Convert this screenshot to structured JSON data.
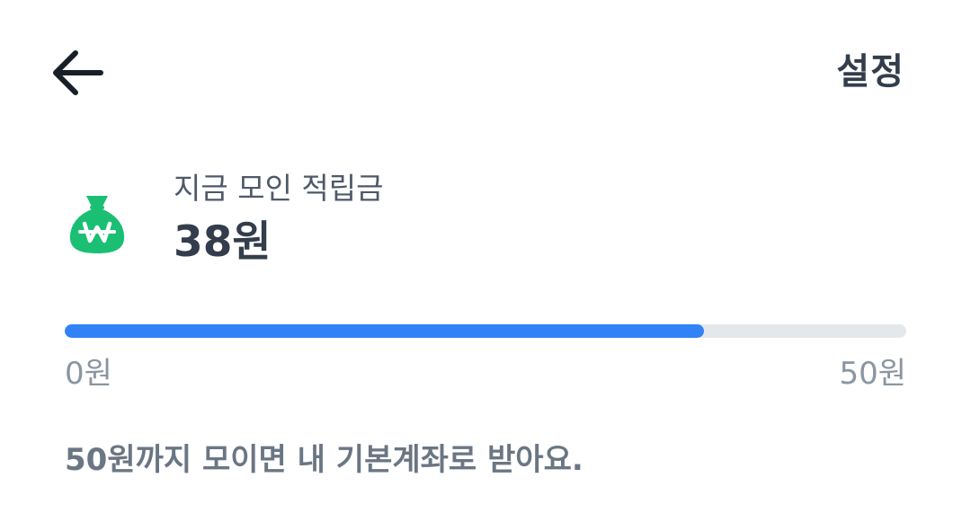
{
  "header": {
    "back_icon": "arrow-left-icon",
    "settings_label": "설정"
  },
  "balance": {
    "icon": "money-bag-won-icon",
    "label": "지금 모인 적립금",
    "amount": "38원"
  },
  "progress": {
    "current": 38,
    "max": 50,
    "fraction": 0.76,
    "min_label": "0원",
    "max_label": "50원"
  },
  "info": {
    "message": "50원까지 모이면 내 기본계좌로 받아요."
  },
  "colors": {
    "accent": "#3182f6",
    "track": "#e5e8eb",
    "icon_green": "#1bbf73",
    "text_primary": "#333d4b",
    "text_secondary": "#4e5968",
    "text_muted": "#8b95a1"
  }
}
